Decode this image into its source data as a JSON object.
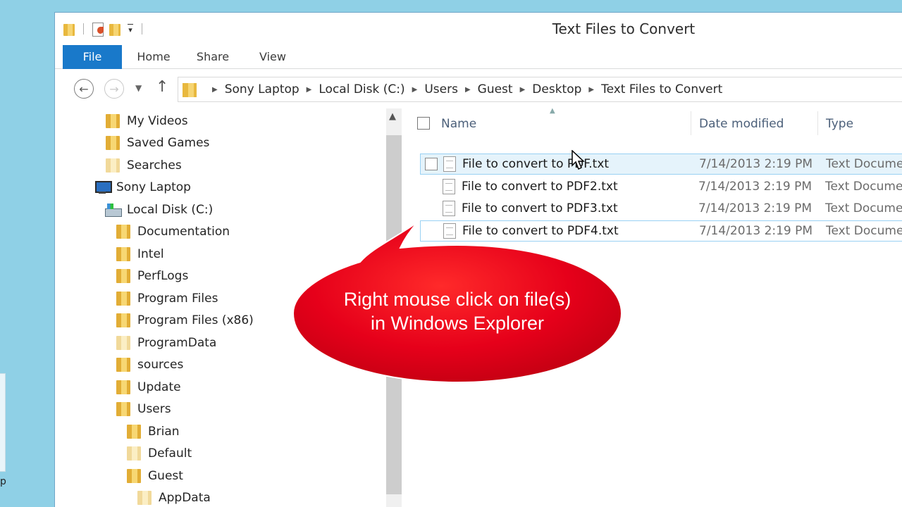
{
  "window": {
    "title": "Text Files to Convert"
  },
  "ribbon": {
    "tabs": [
      "File",
      "Home",
      "Share",
      "View"
    ]
  },
  "address": {
    "crumbs": [
      "Sony Laptop",
      "Local Disk (C:)",
      "Users",
      "Guest",
      "Desktop",
      "Text Files to Convert"
    ]
  },
  "navpane": {
    "items": [
      {
        "label": "My Videos",
        "icon": "videos-folder-icon"
      },
      {
        "label": "Saved Games",
        "icon": "saved-games-folder-icon"
      },
      {
        "label": "Searches",
        "icon": "searches-folder-icon"
      },
      {
        "label": "Sony Laptop",
        "icon": "computer-icon"
      },
      {
        "label": "Local Disk (C:)",
        "icon": "local-disk-icon"
      },
      {
        "label": "Documentation",
        "icon": "folder-icon"
      },
      {
        "label": "Intel",
        "icon": "folder-icon"
      },
      {
        "label": "PerfLogs",
        "icon": "folder-icon"
      },
      {
        "label": "Program Files",
        "icon": "folder-icon"
      },
      {
        "label": "Program Files (x86)",
        "icon": "folder-icon"
      },
      {
        "label": "ProgramData",
        "icon": "hidden-folder-icon"
      },
      {
        "label": "sources",
        "icon": "folder-icon"
      },
      {
        "label": "Update",
        "icon": "folder-icon"
      },
      {
        "label": "Users",
        "icon": "folder-icon"
      },
      {
        "label": "Brian",
        "icon": "folder-icon"
      },
      {
        "label": "Default",
        "icon": "hidden-folder-icon"
      },
      {
        "label": "Guest",
        "icon": "folder-icon"
      },
      {
        "label": "AppData",
        "icon": "hidden-folder-icon"
      }
    ]
  },
  "filelist": {
    "columns": [
      "Name",
      "Date modified",
      "Type"
    ],
    "rows": [
      {
        "name": "File to convert to PDF.txt",
        "date": "7/14/2013 2:19 PM",
        "type": "Text Documen"
      },
      {
        "name": "File to convert to PDF2.txt",
        "date": "7/14/2013 2:19 PM",
        "type": "Text Documen"
      },
      {
        "name": "File to convert to PDF3.txt",
        "date": "7/14/2013 2:19 PM",
        "type": "Text Documen"
      },
      {
        "name": "File to convert to PDF4.txt",
        "date": "7/14/2013 2:19 PM",
        "type": "Text Documen"
      }
    ]
  },
  "callout": {
    "line1": "Right mouse click on file(s)",
    "line2": "in Windows Explorer"
  },
  "colors": {
    "accent": "#1979ca",
    "callout_red": "#e8001b",
    "desktop": "#8fd0e6"
  }
}
